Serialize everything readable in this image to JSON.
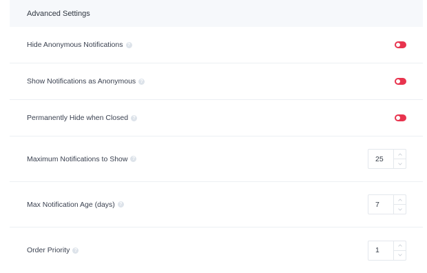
{
  "panel": {
    "title": "Advanced Settings"
  },
  "toggles": [
    {
      "label": "Hide Anonymous Notifications",
      "on": true
    },
    {
      "label": "Show Notifications as Anonymous",
      "on": true
    },
    {
      "label": "Permanently Hide when Closed",
      "on": true
    }
  ],
  "numbers": [
    {
      "label": "Maximum Notifications to Show",
      "value": "25"
    },
    {
      "label": "Max Notification Age (days)",
      "value": "7"
    },
    {
      "label": "Order Priority",
      "value": "1"
    }
  ],
  "colors": {
    "toggle_on": "#e8344e",
    "header_bg": "#f6f8fb",
    "help_icon": "#dde3ea"
  },
  "icons": {
    "help": "question-circle-icon",
    "step_up": "chevron-up-icon",
    "step_down": "chevron-down-icon"
  }
}
